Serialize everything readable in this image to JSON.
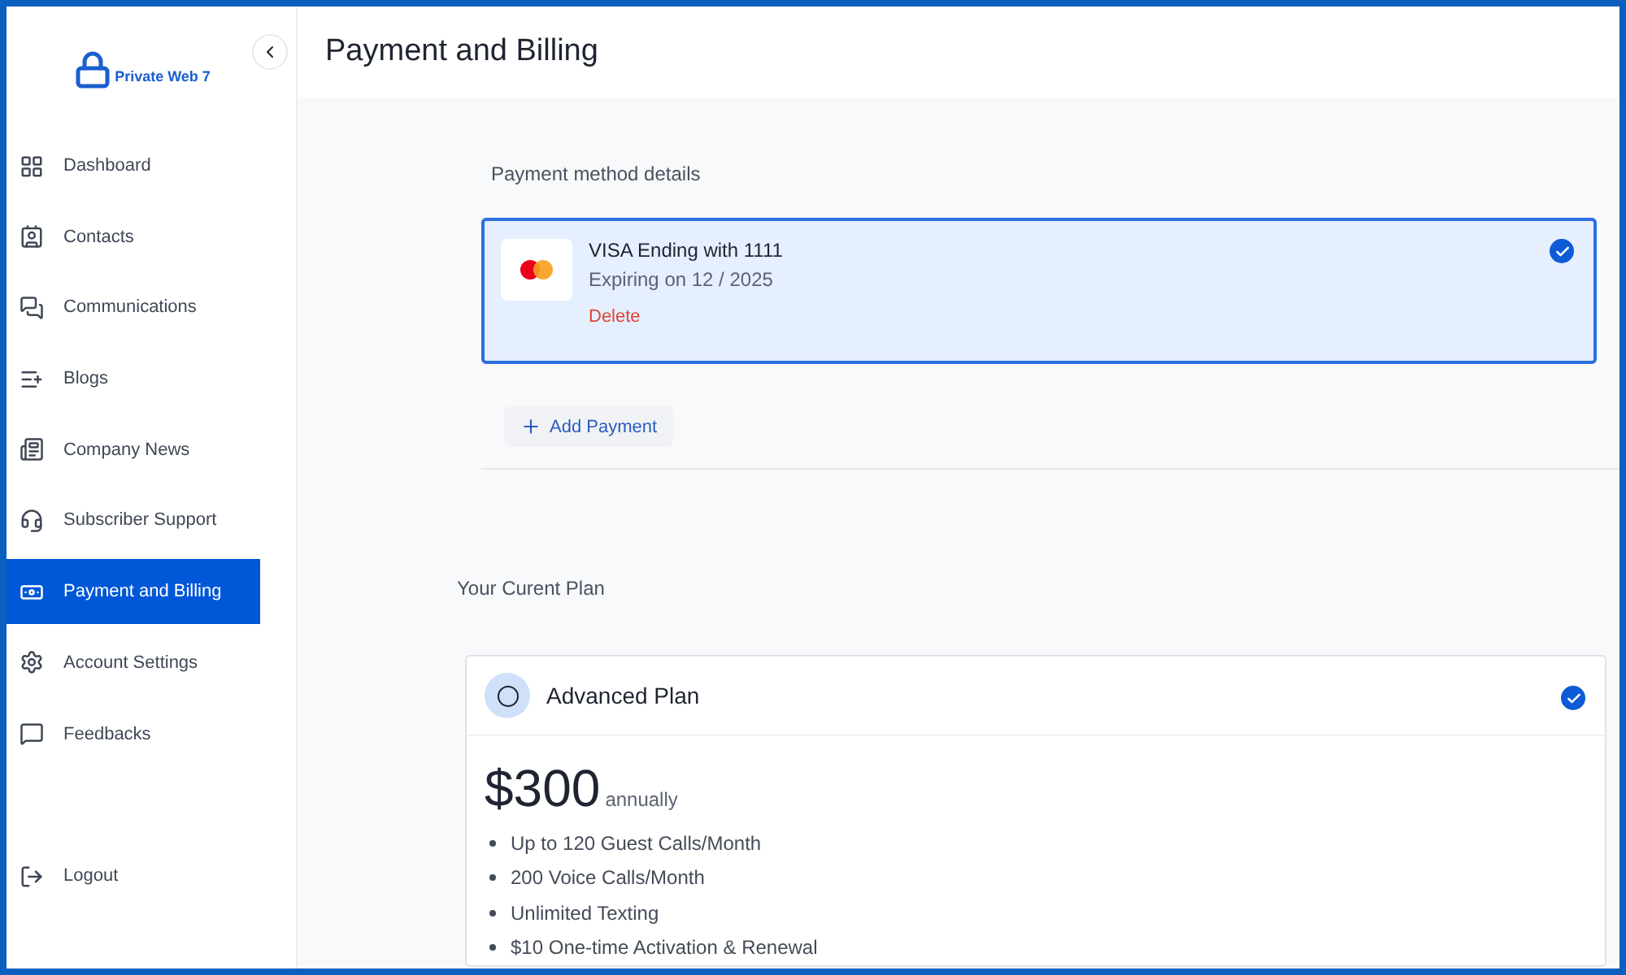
{
  "brand": {
    "name": "Private Web 7"
  },
  "sidebar": {
    "items": [
      {
        "label": "Dashboard",
        "selected": false
      },
      {
        "label": "Contacts",
        "selected": false
      },
      {
        "label": "Communications",
        "selected": false
      },
      {
        "label": "Blogs",
        "selected": false
      },
      {
        "label": "Company News",
        "selected": false
      },
      {
        "label": "Subscriber Support",
        "selected": false
      },
      {
        "label": "Payment and Billing",
        "selected": true
      },
      {
        "label": "Account Settings",
        "selected": false
      },
      {
        "label": "Feedbacks",
        "selected": false
      }
    ],
    "logout": "Logout"
  },
  "header": {
    "title": "Payment and Billing"
  },
  "payment_methods": {
    "title": "Payment method details",
    "cards": [
      {
        "name": "VISA Ending with 1111",
        "expiry": "Expiring on 12 / 2025",
        "delete": "Delete",
        "selected": true
      }
    ],
    "add_button": "Add Payment"
  },
  "plan": {
    "title": "Your Curent Plan",
    "name": "Advanced Plan",
    "selected": true,
    "price": "$300",
    "period": "annually",
    "features": [
      "Up to 120 Guest Calls/Month",
      "200 Voice Calls/Month",
      "Unlimited Texting",
      "$10 One-time Activation & Renewal"
    ]
  }
}
